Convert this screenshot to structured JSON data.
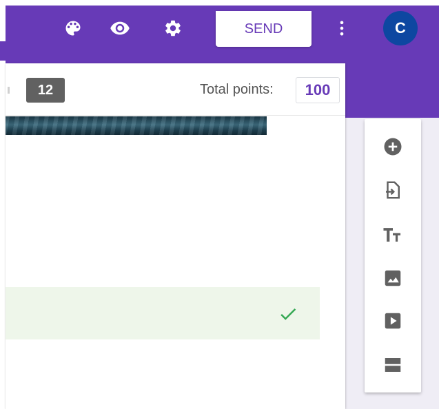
{
  "header": {
    "send_label": "SEND",
    "avatar_initial": "C",
    "icons": [
      "palette-icon",
      "eye-icon",
      "gear-icon",
      "more-vert-icon"
    ]
  },
  "form": {
    "question_count": "12",
    "total_points_label": "Total points:",
    "total_points_value": "100"
  },
  "toolbar": {
    "items": [
      "add-question-icon",
      "import-questions-icon",
      "title-text-icon",
      "image-icon",
      "video-icon",
      "section-icon"
    ]
  },
  "colors": {
    "brand": "#673ab7",
    "avatar": "#0d47a1",
    "correct_bg": "#eef6ea",
    "check": "#34a853",
    "icon_gray": "#616161"
  }
}
